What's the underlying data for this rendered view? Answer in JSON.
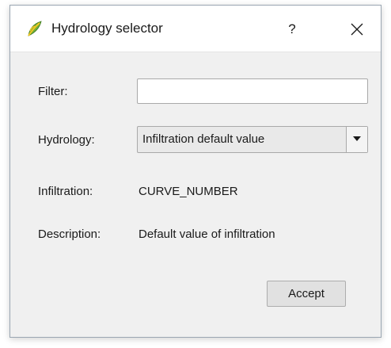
{
  "window": {
    "title": "Hydrology selector",
    "help_label": "?",
    "icon": "qgis-leaf-icon",
    "close_icon": "close-icon"
  },
  "form": {
    "filter_label": "Filter:",
    "filter_value": "",
    "filter_placeholder": "",
    "hydrology_label": "Hydrology:",
    "hydrology_selected": "Infiltration default value",
    "infiltration_label": "Infiltration:",
    "infiltration_value": "CURVE_NUMBER",
    "description_label": "Description:",
    "description_value": "Default value of infiltration"
  },
  "buttons": {
    "accept_label": "Accept"
  },
  "colors": {
    "dialog_bg": "#f0f0f0",
    "titlebar_bg": "#ffffff",
    "border": "#a9a9a9",
    "icon_green": "#6fae3a",
    "icon_yellow": "#f3c622"
  }
}
